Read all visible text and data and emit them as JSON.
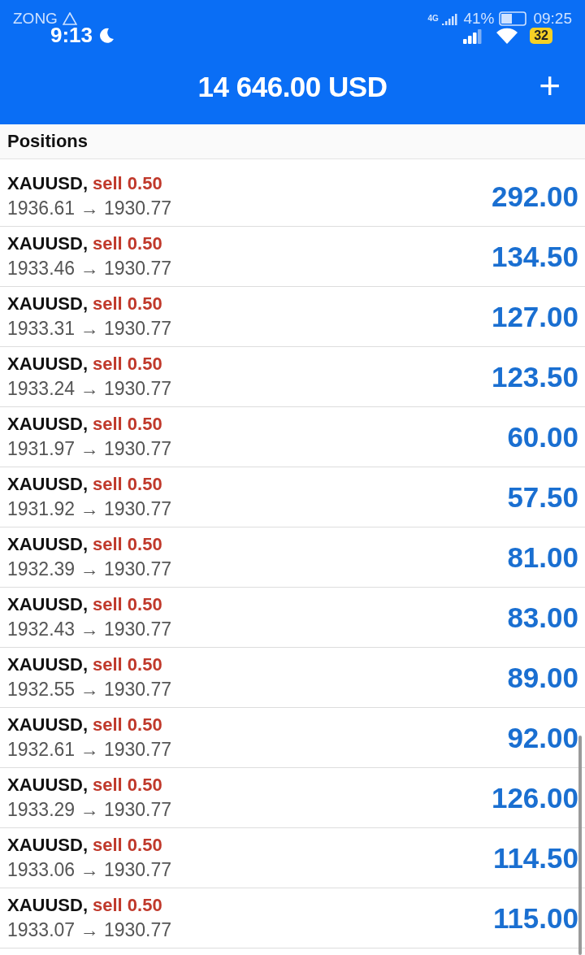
{
  "status_bar": {
    "carrier": "ZONG",
    "time_back": "09:25",
    "battery": "41%",
    "network": "4G",
    "time_front": "9:13",
    "badge": "32"
  },
  "header": {
    "balance": "14 646.00 USD",
    "add": "+"
  },
  "section": {
    "title": "Positions"
  },
  "positions": [
    {
      "symbol": "XAUUSD,",
      "side": "sell 0.50",
      "prices": "1936.61 → 1930.77",
      "profit": "292.00"
    },
    {
      "symbol": "XAUUSD,",
      "side": "sell 0.50",
      "prices": "1933.46 → 1930.77",
      "profit": "134.50"
    },
    {
      "symbol": "XAUUSD,",
      "side": "sell 0.50",
      "prices": "1933.31 → 1930.77",
      "profit": "127.00"
    },
    {
      "symbol": "XAUUSD,",
      "side": "sell 0.50",
      "prices": "1933.24 → 1930.77",
      "profit": "123.50"
    },
    {
      "symbol": "XAUUSD,",
      "side": "sell 0.50",
      "prices": "1931.97 → 1930.77",
      "profit": "60.00"
    },
    {
      "symbol": "XAUUSD,",
      "side": "sell 0.50",
      "prices": "1931.92 → 1930.77",
      "profit": "57.50"
    },
    {
      "symbol": "XAUUSD,",
      "side": "sell 0.50",
      "prices": "1932.39 → 1930.77",
      "profit": "81.00"
    },
    {
      "symbol": "XAUUSD,",
      "side": "sell 0.50",
      "prices": "1932.43 → 1930.77",
      "profit": "83.00"
    },
    {
      "symbol": "XAUUSD,",
      "side": "sell 0.50",
      "prices": "1932.55 → 1930.77",
      "profit": "89.00"
    },
    {
      "symbol": "XAUUSD,",
      "side": "sell 0.50",
      "prices": "1932.61 → 1930.77",
      "profit": "92.00"
    },
    {
      "symbol": "XAUUSD,",
      "side": "sell 0.50",
      "prices": "1933.29 → 1930.77",
      "profit": "126.00"
    },
    {
      "symbol": "XAUUSD,",
      "side": "sell 0.50",
      "prices": "1933.06 → 1930.77",
      "profit": "114.50"
    },
    {
      "symbol": "XAUUSD,",
      "side": "sell 0.50",
      "prices": "1933.07 → 1930.77",
      "profit": "115.00"
    }
  ]
}
